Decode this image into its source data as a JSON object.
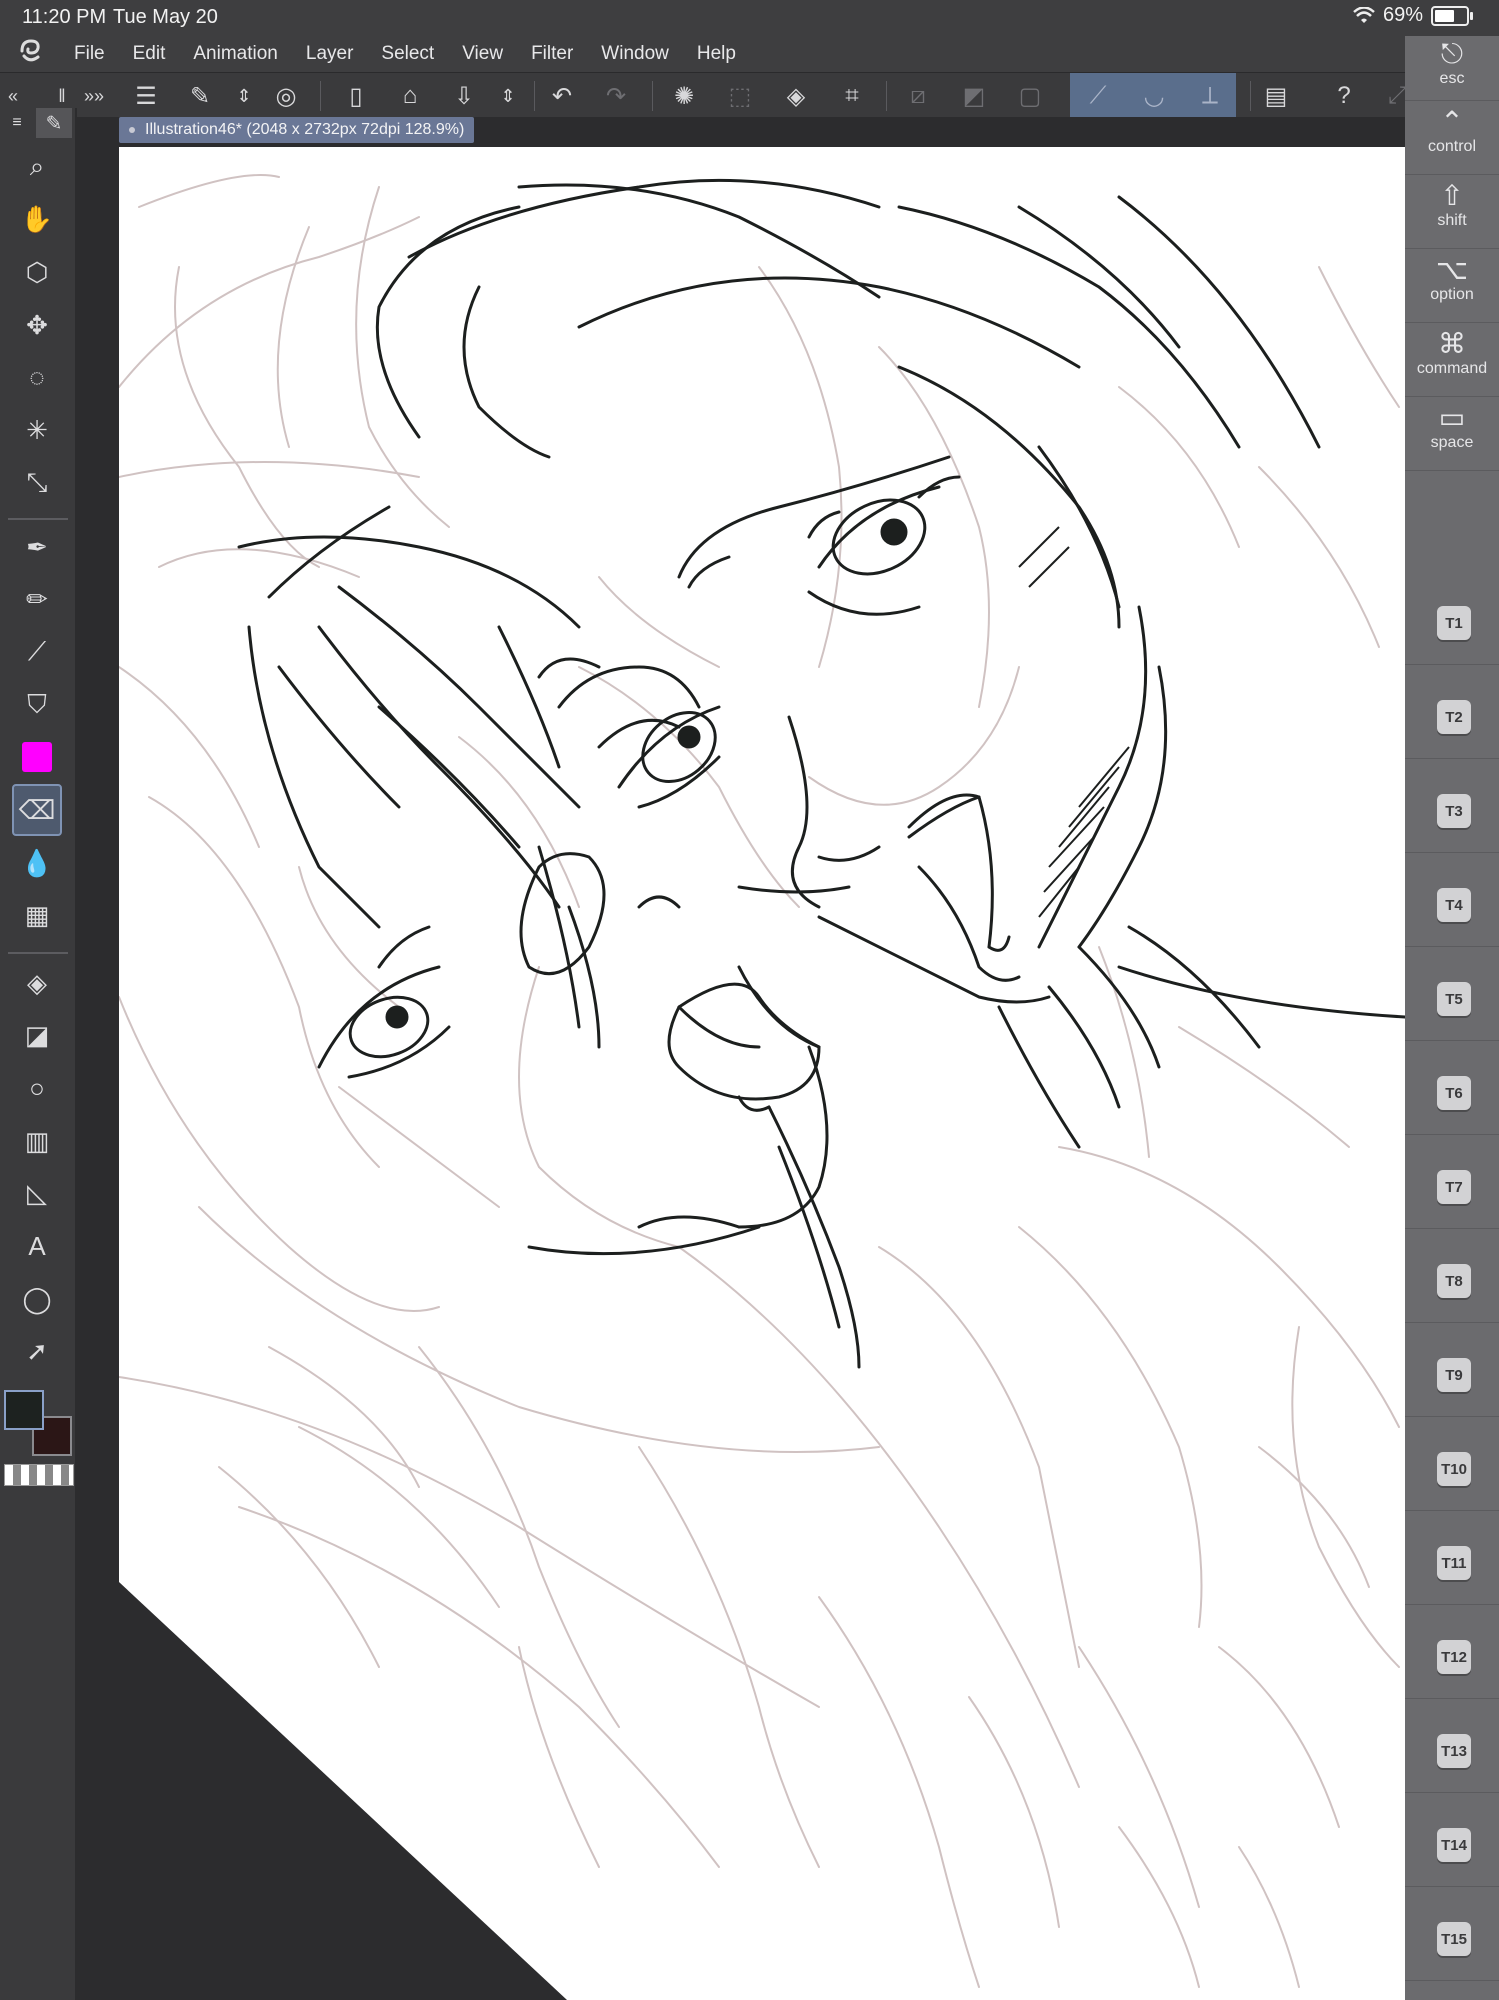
{
  "status": {
    "time": "11:20 PM",
    "date": "Tue May 20",
    "battery": "69%"
  },
  "menu": [
    "File",
    "Edit",
    "Animation",
    "Layer",
    "Select",
    "View",
    "Filter",
    "Window",
    "Help"
  ],
  "document": {
    "tab_label": "Illustration46* (2048 x 2732px 72dpi 128.9%)"
  },
  "toolbar": {
    "icons": [
      "menu-icon",
      "pen-settings-icon",
      "stepper-icon",
      "layer-record-icon",
      "new-canvas-icon",
      "open-folder-icon",
      "save-icon",
      "save-stepper-icon",
      "undo-icon",
      "redo-icon",
      "loading-icon",
      "select-icon",
      "fill-icon",
      "transform-icon",
      "clear-selection-icon",
      "invert-selection-icon",
      "selection-border-icon",
      "stroke-snap-icon",
      "curve-snap-icon",
      "ruler-snap-icon",
      "tablet-icon",
      "help-icon",
      "expand-icon"
    ]
  },
  "left_tools": [
    "brush-tab-icon",
    "zoom-icon",
    "hand-icon",
    "3d-camera-icon",
    "move-icon",
    "lasso-select-icon",
    "magic-wand-icon",
    "eyedropper-icon",
    "pen-icon",
    "pencil-icon",
    "brush-icon",
    "airbrush-icon",
    "decoration-icon",
    "eraser-icon",
    "blend-icon",
    "figure-icon",
    "fill-icon",
    "gradient-icon",
    "shape-icon",
    "frame-icon",
    "ruler-icon",
    "text-icon",
    "balloon-icon",
    "object-select-icon"
  ],
  "colors": {
    "main": "#1d2220",
    "sub": "#2b1616",
    "accent": "#ff00ff",
    "highlight": "#5a6e8c"
  },
  "modifiers": [
    {
      "glyph": "⎋",
      "label": "esc"
    },
    {
      "glyph": "⌃",
      "label": "control"
    },
    {
      "glyph": "⇧",
      "label": "shift"
    },
    {
      "glyph": "⌥",
      "label": "option"
    },
    {
      "glyph": "⌘",
      "label": "command"
    },
    {
      "glyph": "▭",
      "label": "space"
    }
  ],
  "tkeys": [
    "T1",
    "T2",
    "T3",
    "T4",
    "T5",
    "T6",
    "T7",
    "T8",
    "T9",
    "T10",
    "T11",
    "T12",
    "T13",
    "T14",
    "T15"
  ]
}
